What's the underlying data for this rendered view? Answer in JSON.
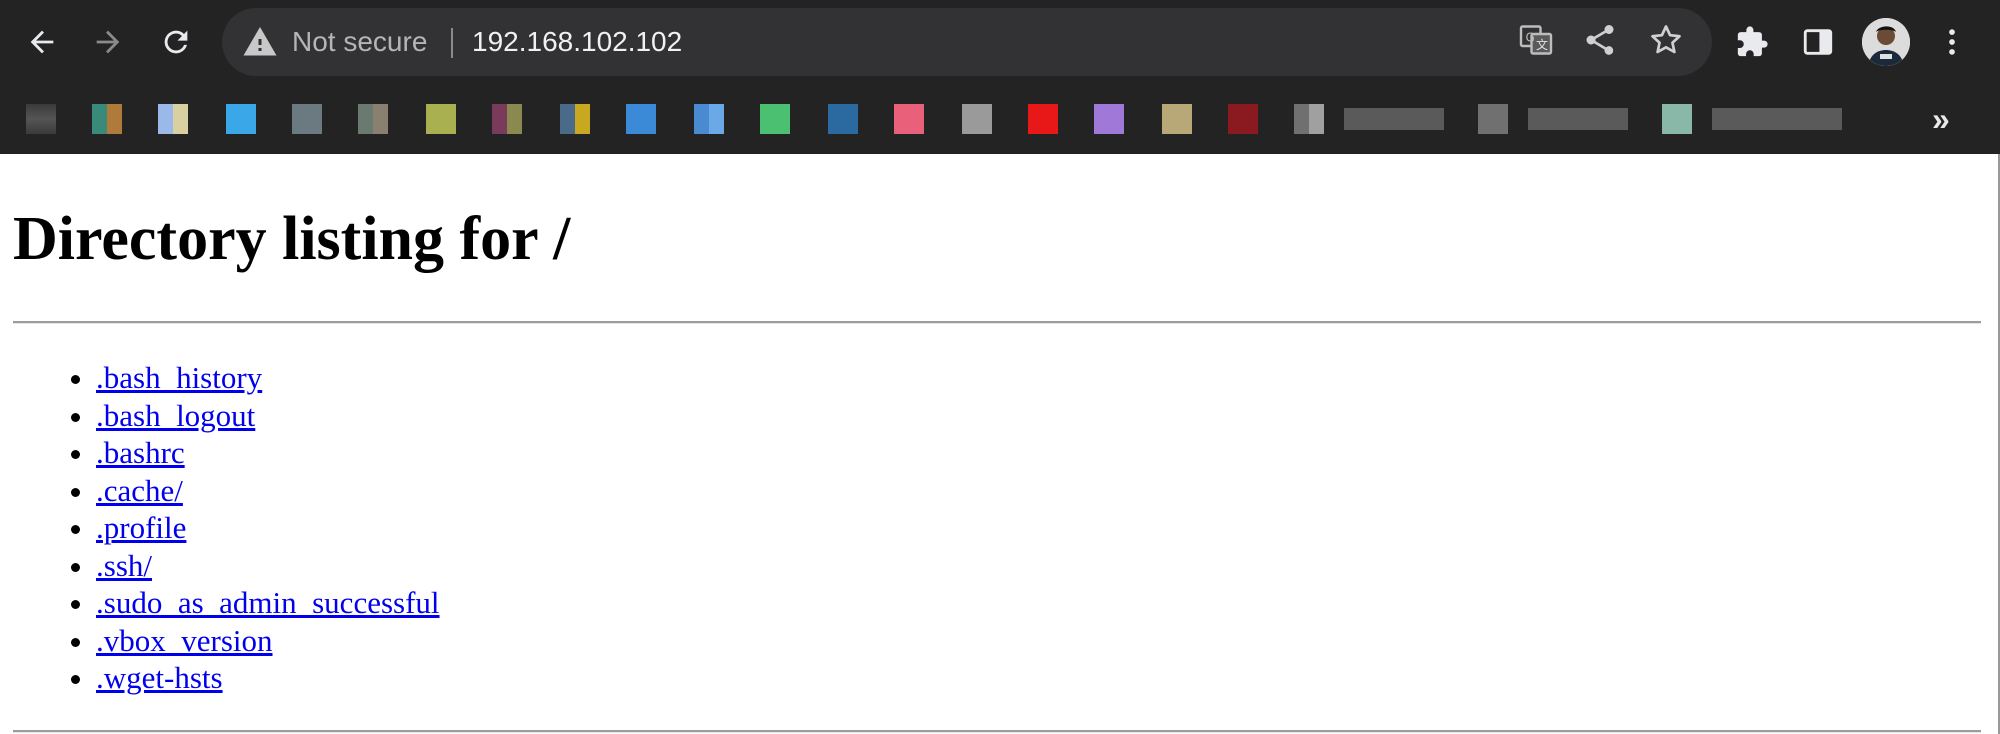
{
  "browser": {
    "address": {
      "security_status": "Not secure",
      "url": "192.168.102.102"
    },
    "nav_icons": [
      "back-icon",
      "forward-icon",
      "reload-icon"
    ],
    "right_icons": [
      "translate-icon",
      "share-icon",
      "star-icon",
      "extensions-icon",
      "side-panel-icon",
      "profile-avatar",
      "menu-icon"
    ],
    "bookmarks_overflow": "»"
  },
  "page": {
    "title": "Directory listing for /",
    "files": [
      ".bash_history",
      ".bash_logout",
      ".bashrc",
      ".cache/",
      ".profile",
      ".ssh/",
      ".sudo_as_admin_successful",
      ".vbox_version",
      ".wget-hsts"
    ]
  },
  "colors": {
    "chrome_bg": "#232323",
    "omnibox_bg": "#323234",
    "link": "#0000ee"
  }
}
